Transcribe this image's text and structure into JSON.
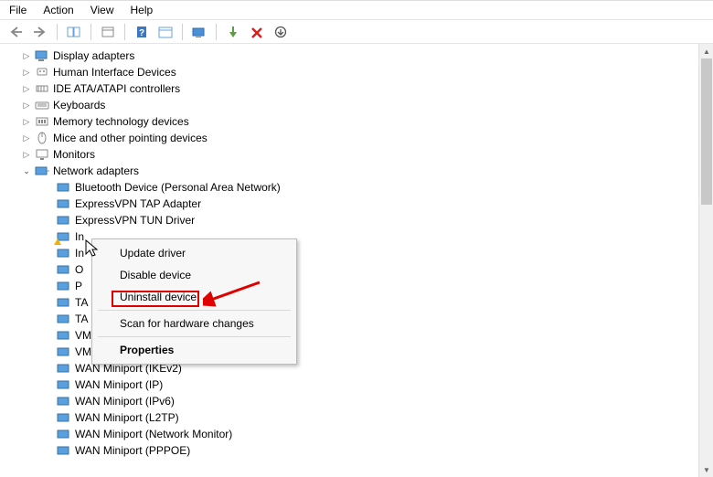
{
  "menubar": {
    "file": "File",
    "action": "Action",
    "view": "View",
    "help": "Help"
  },
  "categories": {
    "display": "Display adapters",
    "hid": "Human Interface Devices",
    "ide": "IDE ATA/ATAPI controllers",
    "keyboards": "Keyboards",
    "memtech": "Memory technology devices",
    "mice": "Mice and other pointing devices",
    "monitors": "Monitors",
    "network": "Network adapters"
  },
  "network_devices": {
    "bluetooth": "Bluetooth Device (Personal Area Network)",
    "tap": "ExpressVPN TAP Adapter",
    "tun": "ExpressVPN TUN Driver",
    "intel": "In",
    "in2": "In",
    "o": "O",
    "p": "P",
    "ta1": "TA",
    "ta2": "TA",
    "vmnet_trunc": "VMware Virtual Ethernet Adapter for VMnet",
    "vmnet8": "VMware Virtual Ethernet Adapter for VMnet8",
    "wan_ikev2": "WAN Miniport (IKEv2)",
    "wan_ip": "WAN Miniport (IP)",
    "wan_ipv6": "WAN Miniport (IPv6)",
    "wan_l2tp": "WAN Miniport (L2TP)",
    "wan_netmon": "WAN Miniport (Network Monitor)",
    "wan_pppoe": "WAN Miniport (PPPOE)"
  },
  "context_menu": {
    "update": "Update driver",
    "disable": "Disable device",
    "uninstall": "Uninstall device",
    "scan": "Scan for hardware changes",
    "properties": "Properties"
  }
}
